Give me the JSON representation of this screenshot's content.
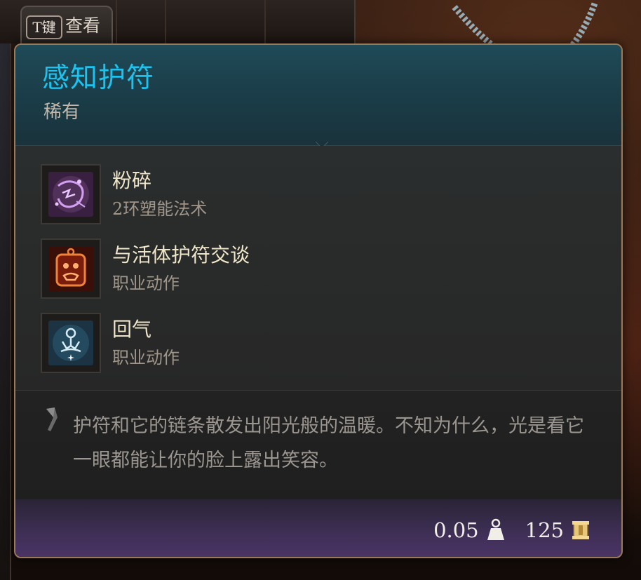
{
  "hotkey": {
    "key": "T键",
    "label": "查看"
  },
  "item": {
    "name": "感知护符",
    "rarity": "稀有",
    "name_color": "#1cc3ef"
  },
  "abilities": [
    {
      "name": "粉碎",
      "type": "2环塑能法术",
      "icon": "shatter-spell-icon"
    },
    {
      "name": "与活体护符交谈",
      "type": "职业动作",
      "icon": "talk-to-amulet-icon"
    },
    {
      "name": "回气",
      "type": "职业动作",
      "icon": "meditate-icon"
    }
  ],
  "description": "护符和它的链条散发出阳光般的温暖。不知为什么，光是看它一眼都能让你的脸上露出笑容。",
  "footer": {
    "weight": "0.05",
    "weight_icon": "weight-icon",
    "value": "125",
    "value_icon": "gold-coin-icon"
  }
}
